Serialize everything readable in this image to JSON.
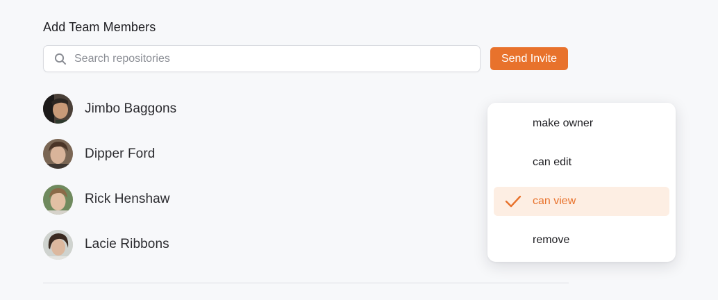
{
  "header": {
    "title": "Add Team Members"
  },
  "search": {
    "placeholder": "Search repositories",
    "value": ""
  },
  "invite": {
    "label": "Send Invite"
  },
  "members": [
    {
      "name": "Jimbo Baggons"
    },
    {
      "name": "Dipper Ford"
    },
    {
      "name": "Rick Henshaw"
    },
    {
      "name": "Lacie Ribbons"
    }
  ],
  "permission_menu": {
    "items": [
      {
        "label": "make owner",
        "selected": false
      },
      {
        "label": "can edit",
        "selected": false
      },
      {
        "label": "can view",
        "selected": true
      },
      {
        "label": "remove",
        "selected": false
      }
    ]
  },
  "colors": {
    "accent": "#e8722c",
    "selected_bg": "#fdeee3",
    "background": "#f7f8fa"
  },
  "icons": {
    "search": "search-icon",
    "check": "checkmark-icon"
  }
}
